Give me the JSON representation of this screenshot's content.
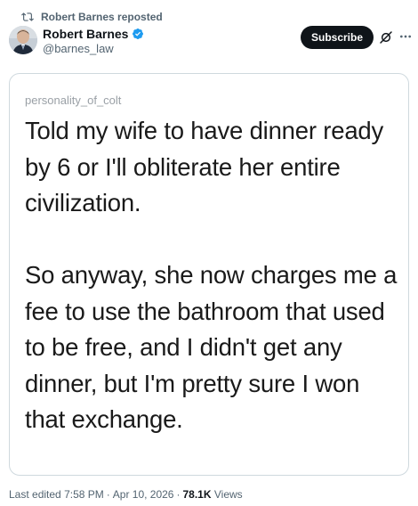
{
  "repost": {
    "label": "Robert Barnes reposted",
    "icon": "repost-icon"
  },
  "author": {
    "display_name": "Robert Barnes",
    "handle": "@barnes_law",
    "verified": true,
    "verified_color": "#1d9bf0"
  },
  "actions": {
    "subscribe_label": "Subscribe",
    "grok_icon": "grok-icon",
    "more_icon": "more-icon"
  },
  "post_image": {
    "username": "personality_of_colt",
    "text": "Told my wife to have dinner ready by 6 or I'll obliterate her entire civilization.\n\nSo anyway, she now charges me a fee to use the bathroom that used to be free, and I didn't get any dinner, but I'm pretty sure I won that exchange."
  },
  "meta": {
    "edited_label": "Last edited",
    "time": "7:58 PM",
    "date": "Apr 10, 2026",
    "views_count": "78.1K",
    "views_label": "Views",
    "separator": "·"
  }
}
